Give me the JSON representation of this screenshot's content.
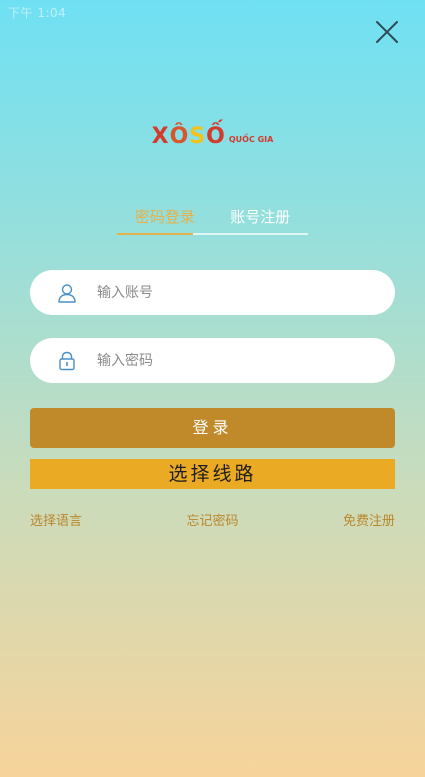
{
  "status_bar": {
    "text": "下午 1:04"
  },
  "logo": {
    "letters": [
      "X",
      "Ô",
      "S",
      "Ố"
    ],
    "subtitle": "QUỐC GIA"
  },
  "tabs": [
    {
      "label": "密码登录",
      "active": true
    },
    {
      "label": "账号注册",
      "active": false
    }
  ],
  "form": {
    "account": {
      "placeholder": "输入账号",
      "value": ""
    },
    "password": {
      "placeholder": "输入密码",
      "value": ""
    }
  },
  "buttons": {
    "login_label": "登录",
    "route_label": "选择线路"
  },
  "links": {
    "language": "选择语言",
    "forgot_password": "忘记密码",
    "register": "免费注册"
  },
  "icons": {
    "close": "close-icon",
    "user": "user-icon",
    "lock": "lock-icon"
  },
  "colors": {
    "accent": "#e6b14a",
    "login_button": "#c08a2b",
    "route_button": "#ebaa23",
    "link_text": "#b9872d",
    "icon_blue": "#4a90c8",
    "close_icon": "#2e4a57",
    "logo_red": "#d33b2c",
    "logo_blue": "#1d3f9e",
    "logo_yellow": "#f3c21b"
  }
}
